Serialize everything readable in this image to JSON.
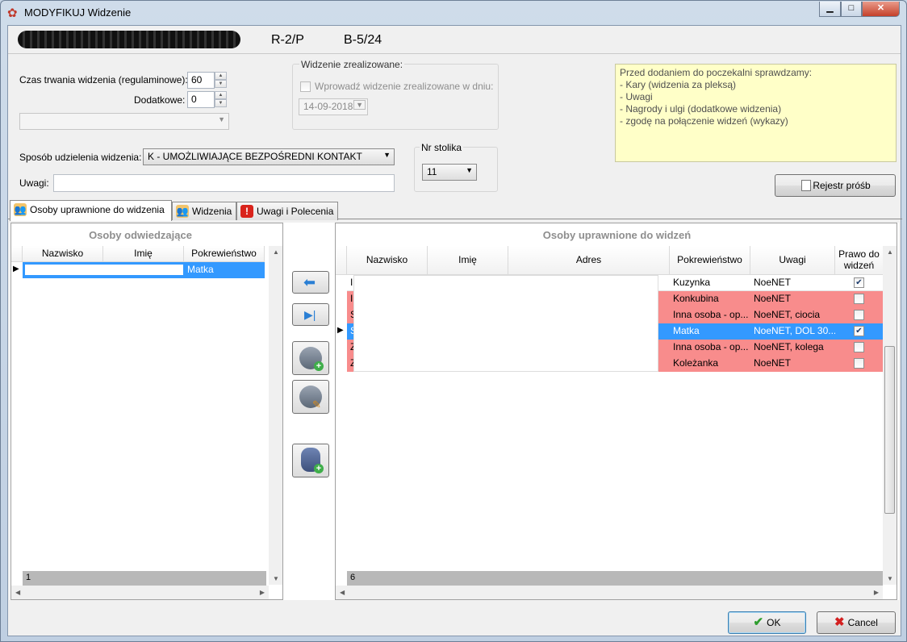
{
  "window": {
    "title": "MODYFIKUJ Widzenie",
    "controls": {
      "minimize": "▁",
      "maximize": "□",
      "close": "✕"
    }
  },
  "header": {
    "code1": "R-2/P",
    "code2": "B-5/24"
  },
  "form": {
    "duration_label": "Czas trwania widzenia (regulaminowe):",
    "duration_value": "60",
    "additional_label": "Dodatkowe:",
    "additional_value": "0",
    "realized_group_title": "Widzenie zrealizowane:",
    "realized_checkbox_label": "Wprowadź widzenie zrealizowane w dniu:",
    "realized_date": "14-09-2018",
    "method_label": "Sposób udzielenia widzenia:",
    "method_value": "K - UMOŻLIWIAJĄCE BEZPOŚREDNI KONTAKT",
    "table_group_title": "Nr stolika",
    "table_value": "11",
    "notes_label": "Uwagi:",
    "notes_value": ""
  },
  "info_box": {
    "lines": [
      "Przed dodaniem do poczekalni sprawdzamy:",
      "- Kary (widzenia za pleksą)",
      "- Uwagi",
      "- Nagrody i ulgi (dodatkowe widzenia)",
      "- zgodę na połączenie widzeń (wykazy)"
    ]
  },
  "buttons": {
    "register": "Rejestr próśb",
    "ok": "OK",
    "cancel": "Cancel"
  },
  "tabs": [
    {
      "label": "Osoby uprawnione do widzenia"
    },
    {
      "label": "Widzenia"
    },
    {
      "label": "Uwagi i Polecenia"
    }
  ],
  "visitors": {
    "title": "Osoby odwiedzające",
    "columns": [
      "Nazwisko",
      "Imię",
      "Pokrewieństwo"
    ],
    "rows": [
      {
        "relation": "Matka"
      }
    ],
    "count": "1"
  },
  "authorized": {
    "title": "Osoby uprawnione do widzeń",
    "columns": [
      "Nazwisko",
      "Imię",
      "Adres",
      "Pokrewieństwo",
      "Uwagi",
      "Prawo do widzeń"
    ],
    "rows": [
      {
        "prefix": "I",
        "relation": "Kuzynka",
        "notes": "NoeNET",
        "right": true,
        "style": "white"
      },
      {
        "prefix": "I",
        "relation": "Konkubina",
        "notes": "NoeNET",
        "right": false,
        "style": "pink"
      },
      {
        "prefix": "S",
        "relation": "Inna osoba - op...",
        "notes": "NoeNET, ciocia",
        "right": false,
        "style": "pink"
      },
      {
        "prefix": "S",
        "relation": "Matka",
        "notes": "NoeNET, DOL 30...",
        "right": true,
        "style": "selected"
      },
      {
        "prefix": "Z",
        "relation": "Inna osoba - op...",
        "notes": "NoeNET, kolega",
        "right": false,
        "style": "pink"
      },
      {
        "prefix": "Z",
        "relation": "Koleżanka",
        "notes": "NoeNET",
        "right": false,
        "style": "pink"
      }
    ],
    "count": "6"
  },
  "colors": {
    "pink_row": "#f88c8c",
    "selected_row": "#3399ff",
    "note_bg": "#ffffc8"
  }
}
